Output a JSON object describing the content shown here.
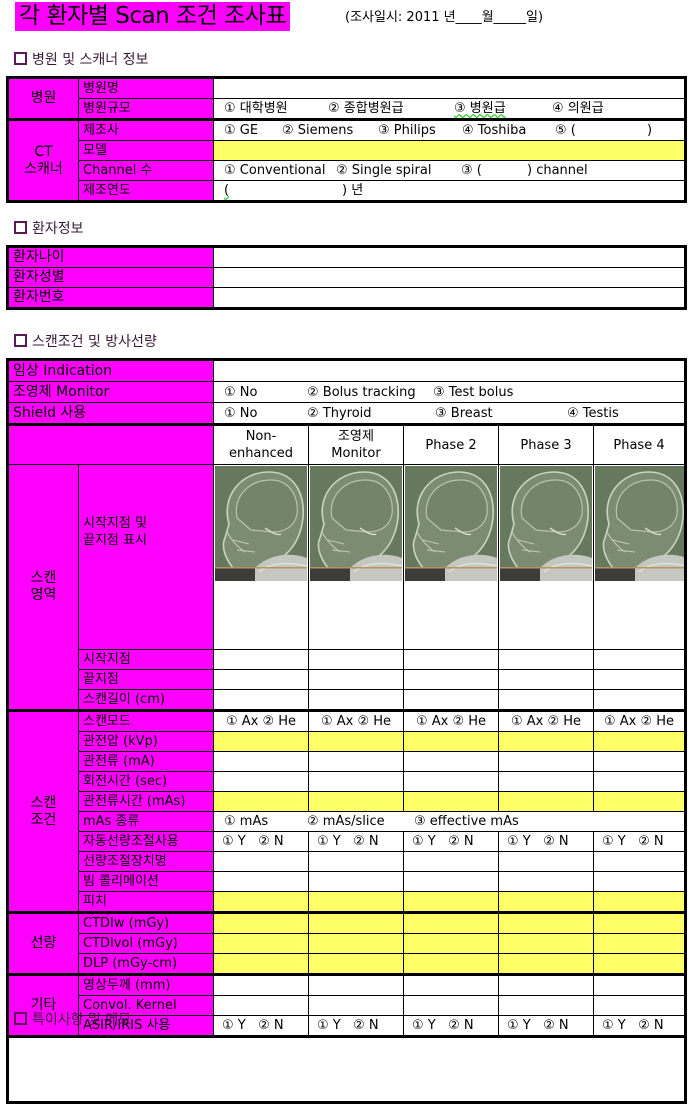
{
  "header": {
    "title": "각 환자별 Scan 조건 조사표",
    "subtitle": "(조사일시: 2011 년____월_____일)"
  },
  "colors": {
    "label_bg": "#ff00ff",
    "highlight_bg": "#ffff66",
    "border": "#000000"
  },
  "sections": {
    "hospital": "병원 및 스캐너 정보",
    "patient": "환자정보",
    "scan": "스캔조건 및 방사선량",
    "memo": "특이사항 및 메모"
  },
  "hospital_table": {
    "group_hospital": "병원",
    "hospital_name": "병원명",
    "hospital_scale": "병원규모",
    "scale_options": [
      "① 대학병원",
      "② 종합병원급",
      "③ 병원급",
      "④ 의원급"
    ],
    "group_scanner": "CT\n스캐너",
    "group_scanner_l1": "CT",
    "group_scanner_l2": "스캐너",
    "manufacturer": "제조사",
    "manufacturer_options": [
      "① GE",
      "② Siemens",
      "③ Philips",
      "④ Toshiba",
      "⑤ (",
      ")"
    ],
    "model": "모델",
    "channel": "Channel 수",
    "channel_options": [
      "① Conventional",
      "② Single spiral",
      "③ (",
      ") channel"
    ],
    "year": "제조연도",
    "year_value_open": "(",
    "year_value_close": ") 년"
  },
  "patient_table": {
    "rows": [
      "환자나이",
      "환자성별",
      "환자번호"
    ]
  },
  "scan_table": {
    "indication": "임상 Indication",
    "contrast_monitor": "조영제 Monitor",
    "contrast_options": [
      "① No",
      "② Bolus tracking",
      "③ Test bolus"
    ],
    "shield": "Shield 사용",
    "shield_options": [
      "① No",
      "② Thyroid",
      "③ Breast",
      "④ Testis"
    ],
    "phases": [
      {
        "l1": "Non-",
        "l2": "enhanced"
      },
      {
        "l1": "조영제",
        "l2": "Monitor"
      },
      {
        "l1": "Phase 2",
        "l2": ""
      },
      {
        "l1": "Phase 3",
        "l2": ""
      },
      {
        "l1": "Phase 4",
        "l2": ""
      }
    ],
    "scan_area": {
      "group_l1": "스캔",
      "group_l2": "영역",
      "marking_l1": "시작지점 및",
      "marking_l2": "끝지점 표시",
      "start": "시작지점",
      "end": "끝지점",
      "length": "스캔길이 (cm)",
      "image_icon": "skull-lateral-scout-image"
    },
    "scan_conditions": {
      "group_l1": "스캔",
      "group_l2": "조건",
      "mode": "스캔모드",
      "mode_option": "① Ax ② He",
      "kvp": "관전압 (kVp)",
      "ma": "관전류 (mA)",
      "rotation": "회전시간 (sec)",
      "mas": "관전류시간 (mAs)",
      "mas_type": "mAs 종류",
      "mas_type_options": [
        "① mAs",
        "② mAs/slice",
        "③ effective mAs"
      ],
      "aec": "자동선량조절사용",
      "yn_option": "① Y   ② N",
      "aec_device": "선량조절장치명",
      "collimation": "빔 콜리메이션",
      "pitch": "피치"
    },
    "dose": {
      "group": "선량",
      "ctdiw": "CTDIw (mGy)",
      "ctdivol": "CTDIvol (mGy)",
      "dlp": "DLP (mGy-cm)"
    },
    "other": {
      "group": "기타",
      "thickness": "영상두께 (mm)",
      "kernel": "Convol. Kernel",
      "asir": "ASIR/IRIS 사용",
      "yn_option": "① Y   ② N"
    }
  },
  "memo": {
    "value": ""
  }
}
